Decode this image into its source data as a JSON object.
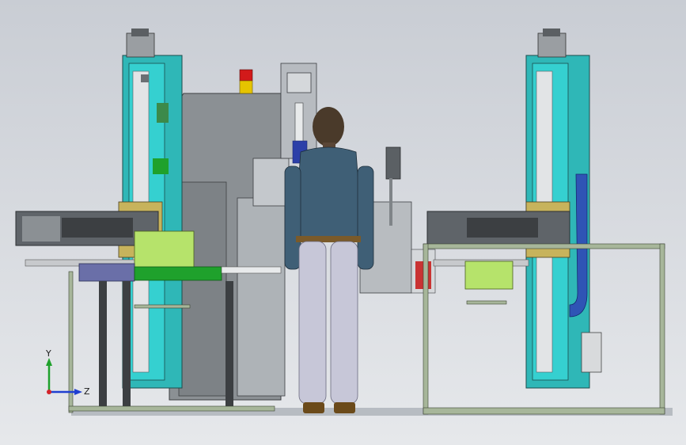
{
  "viewport": {
    "background_top": "#c9cdd4",
    "background_bottom": "#e6e8eb"
  },
  "triad": {
    "y_label": "Y",
    "z_label": "Z",
    "x_color": "#d2232a",
    "y_color": "#1fa12c",
    "z_color": "#1f3fd0"
  },
  "colors": {
    "column_teal": "#2fb7b7",
    "column_cyan": "#35d0d0",
    "cabinet_gray": "#8b9094",
    "frame_green": "#a7b69a",
    "tray_lime": "#b6e36b",
    "head_purple": "#6a6fa8",
    "warning_yellow": "#e5c400",
    "warning_red": "#d21a1a",
    "accent_blue": "#2f54b5",
    "figure_jacket": "#3f5f76",
    "figure_pants": "#c7c7d8"
  }
}
